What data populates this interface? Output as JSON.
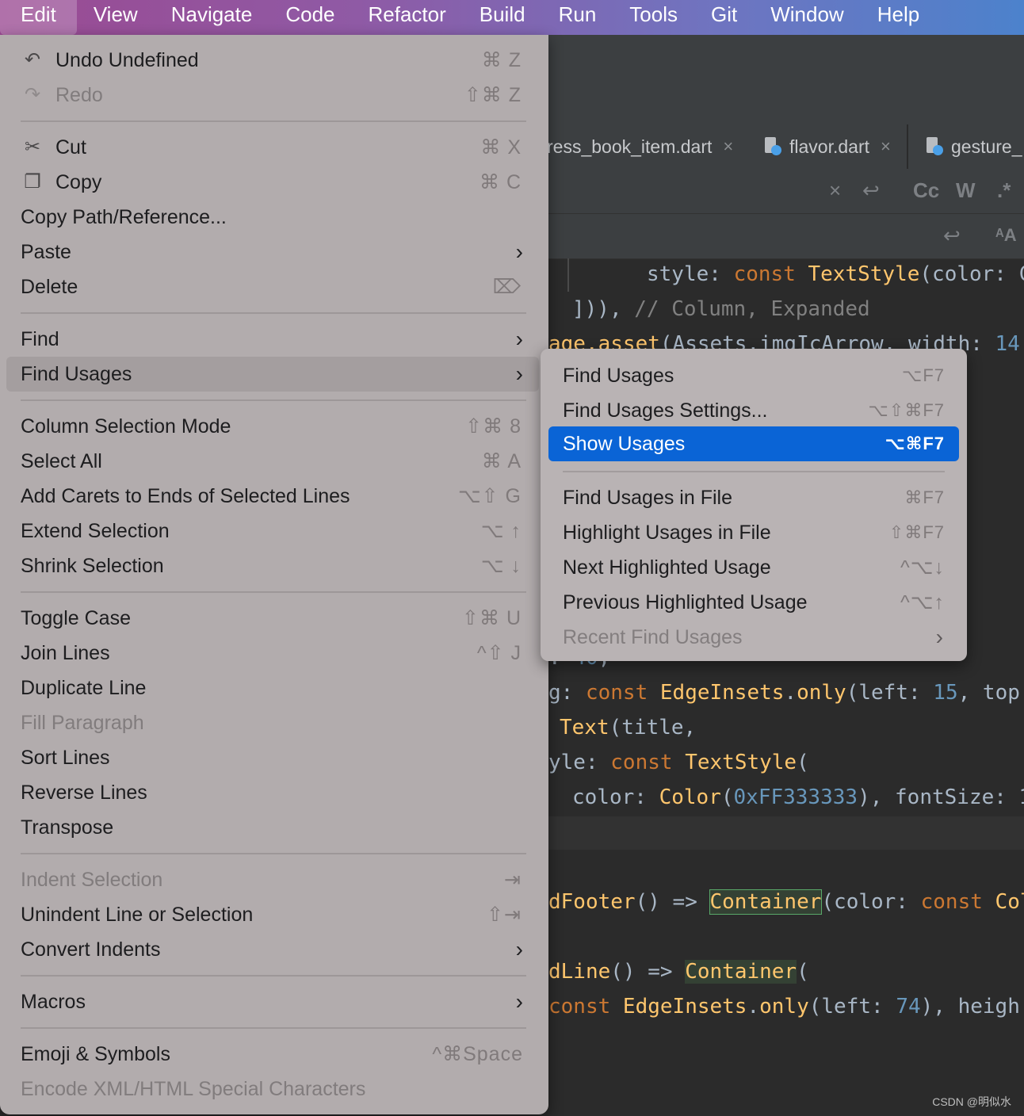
{
  "menubar": {
    "items": [
      "Edit",
      "View",
      "Navigate",
      "Code",
      "Refactor",
      "Build",
      "Run",
      "Tools",
      "Git",
      "Window",
      "Help"
    ]
  },
  "editor": {
    "tabs": [
      {
        "label": "ress_book_item.dart",
        "icon": "dart-file-icon"
      },
      {
        "label": "flavor.dart",
        "icon": "dart-file-icon"
      },
      {
        "label": "gesture_",
        "icon": "dart-file-icon"
      }
    ],
    "find_toolbar": {
      "close": "×",
      "match_case": "Cc",
      "words": "W",
      "regex": ".*"
    },
    "watermark": "CSDN @明似水"
  },
  "edit_menu": {
    "items": [
      {
        "label": "Undo Undefined",
        "shortcut": "⌘ Z",
        "icon": "undo-icon"
      },
      {
        "label": "Redo",
        "shortcut": "⇧⌘ Z",
        "icon": "redo-icon",
        "disabled": true
      },
      {
        "label": "Cut",
        "shortcut": "⌘ X",
        "icon": "scissors-icon"
      },
      {
        "label": "Copy",
        "shortcut": "⌘ C",
        "icon": "copy-icon"
      },
      {
        "label": "Copy Path/Reference...",
        "shortcut": ""
      },
      {
        "label": "Paste",
        "shortcut": "",
        "submenu": true
      },
      {
        "label": "Delete",
        "shortcut": "⌦"
      },
      {
        "label": "Find",
        "shortcut": "",
        "submenu": true
      },
      {
        "label": "Find Usages",
        "shortcut": "",
        "submenu": true,
        "highlight": true
      },
      {
        "label": "Column Selection Mode",
        "shortcut": "⇧⌘ 8"
      },
      {
        "label": "Select All",
        "shortcut": "⌘ A"
      },
      {
        "label": "Add Carets to Ends of Selected Lines",
        "shortcut": "⌥⇧ G"
      },
      {
        "label": "Extend Selection",
        "shortcut": "⌥ ↑"
      },
      {
        "label": "Shrink Selection",
        "shortcut": "⌥ ↓"
      },
      {
        "label": "Toggle Case",
        "shortcut": "⇧⌘ U"
      },
      {
        "label": "Join Lines",
        "shortcut": "^⇧ J"
      },
      {
        "label": "Duplicate Line",
        "shortcut": ""
      },
      {
        "label": "Fill Paragraph",
        "shortcut": "",
        "disabled": true
      },
      {
        "label": "Sort Lines",
        "shortcut": ""
      },
      {
        "label": "Reverse Lines",
        "shortcut": ""
      },
      {
        "label": "Transpose",
        "shortcut": ""
      },
      {
        "label": "Indent Selection",
        "shortcut": "⇥",
        "disabled": true
      },
      {
        "label": "Unindent Line or Selection",
        "shortcut": "⇧⇥"
      },
      {
        "label": "Convert Indents",
        "shortcut": "",
        "submenu": true
      },
      {
        "label": "Macros",
        "shortcut": "",
        "submenu": true
      },
      {
        "label": "Emoji & Symbols",
        "shortcut": "^⌘Space"
      },
      {
        "label": "Encode XML/HTML Special Characters",
        "shortcut": "",
        "disabled": true
      }
    ]
  },
  "find_usages_submenu": {
    "items": [
      {
        "label": "Find Usages",
        "shortcut": "⌥F7"
      },
      {
        "label": "Find Usages Settings...",
        "shortcut": "⌥⇧⌘F7"
      },
      {
        "label": "Show Usages",
        "shortcut": "⌥⌘F7",
        "selected": true
      },
      {
        "label": "Find Usages in File",
        "shortcut": "⌘F7"
      },
      {
        "label": "Highlight Usages in File",
        "shortcut": "⇧⌘F7"
      },
      {
        "label": "Next Highlighted Usage",
        "shortcut": "^⌥↓"
      },
      {
        "label": "Previous Highlighted Usage",
        "shortcut": "^⌥↑"
      },
      {
        "label": "Recent Find Usages",
        "shortcut": "",
        "submenu": true,
        "disabled": true
      }
    ]
  },
  "colors": {
    "menubar_gradient_start": "#9a4a92",
    "menubar_gradient_end": "#4c82cc",
    "menu_bg": "#b2acad",
    "selection_blue": "#0a64d6",
    "editor_bg": "#2b2b2b"
  }
}
